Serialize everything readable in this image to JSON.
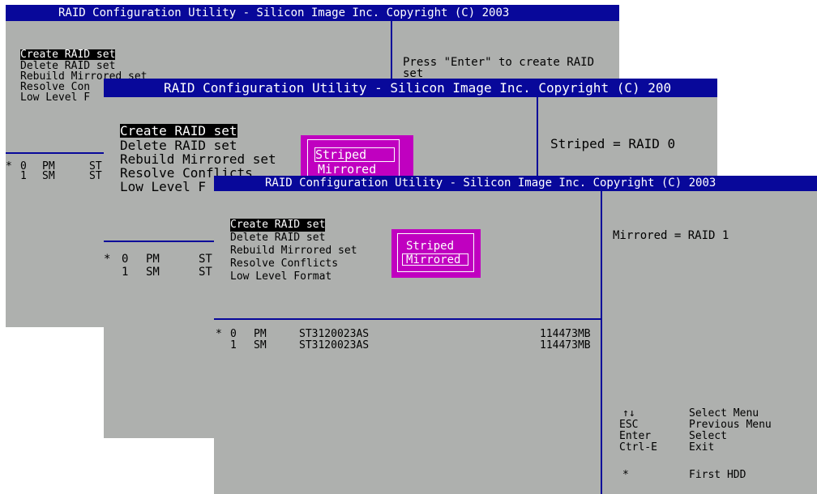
{
  "title": "RAID Configuration Utility - Silicon Image Inc. Copyright (C) 2003",
  "colors": {
    "title_bar": "#08089a",
    "background": "#aeb0ae",
    "popup": "#c000c0",
    "selection": "#000000"
  },
  "menu": [
    "Create RAID set",
    "Delete RAID set",
    "Rebuild Mirrored set",
    "Resolve Conflicts",
    "Low Level Format"
  ],
  "raid_types": [
    "Striped",
    "Mirrored"
  ],
  "screen1": {
    "title": "RAID Configuration Utility - Silicon Image Inc. Copyright (C) 2003",
    "menu": [
      "Create RAID set",
      "Delete RAID set",
      "Rebuild Mirrored set",
      "Resolve Con",
      "Low Level F"
    ],
    "selected_menu": "Create RAID set",
    "help_line1": "Press \"Enter\" to create RAID",
    "help_line2": "set",
    "drives": [
      {
        "star": "*",
        "num": "0",
        "role": "PM",
        "model": "ST"
      },
      {
        "star": "",
        "num": "1",
        "role": "SM",
        "model": "ST"
      }
    ]
  },
  "screen2": {
    "title": "RAID Configuration Utility - Silicon Image Inc. Copyright (C) 200",
    "menu": [
      "Create RAID set",
      "Delete RAID set",
      "Rebuild Mirrored set",
      "Resolve Conflicts",
      "Low Level F"
    ],
    "selected_menu": "Create RAID set",
    "help": "Striped = RAID 0",
    "popup_selected": "Striped",
    "popup_options": [
      "Striped",
      "Mirrored"
    ],
    "drives": [
      {
        "star": "*",
        "num": "0",
        "role": "PM",
        "model": "ST"
      },
      {
        "star": "",
        "num": "1",
        "role": "SM",
        "model": "ST"
      }
    ]
  },
  "screen3": {
    "title": "RAID Configuration Utility - Silicon Image Inc. Copyright (C) 2003",
    "menu": [
      "Create RAID set",
      "Delete RAID set",
      "Rebuild Mirrored set",
      "Resolve Conflicts",
      "Low Level Format"
    ],
    "selected_menu": "Create RAID set",
    "help": "Mirrored = RAID 1",
    "popup_selected": "Mirrored",
    "popup_options": [
      "Striped",
      "Mirrored"
    ],
    "drives": [
      {
        "star": "*",
        "num": "0",
        "role": "PM",
        "model": "ST3120023AS",
        "size": "114473MB"
      },
      {
        "star": "",
        "num": "1",
        "role": "SM",
        "model": "ST3120023AS",
        "size": "114473MB"
      }
    ],
    "legend": [
      {
        "key": "↑↓",
        "action": "Select Menu"
      },
      {
        "key": "ESC",
        "action": "Previous Menu"
      },
      {
        "key": "Enter",
        "action": "Select"
      },
      {
        "key": "Ctrl-E",
        "action": "Exit"
      }
    ],
    "legend_note": {
      "key": "*",
      "action": "First HDD"
    }
  }
}
